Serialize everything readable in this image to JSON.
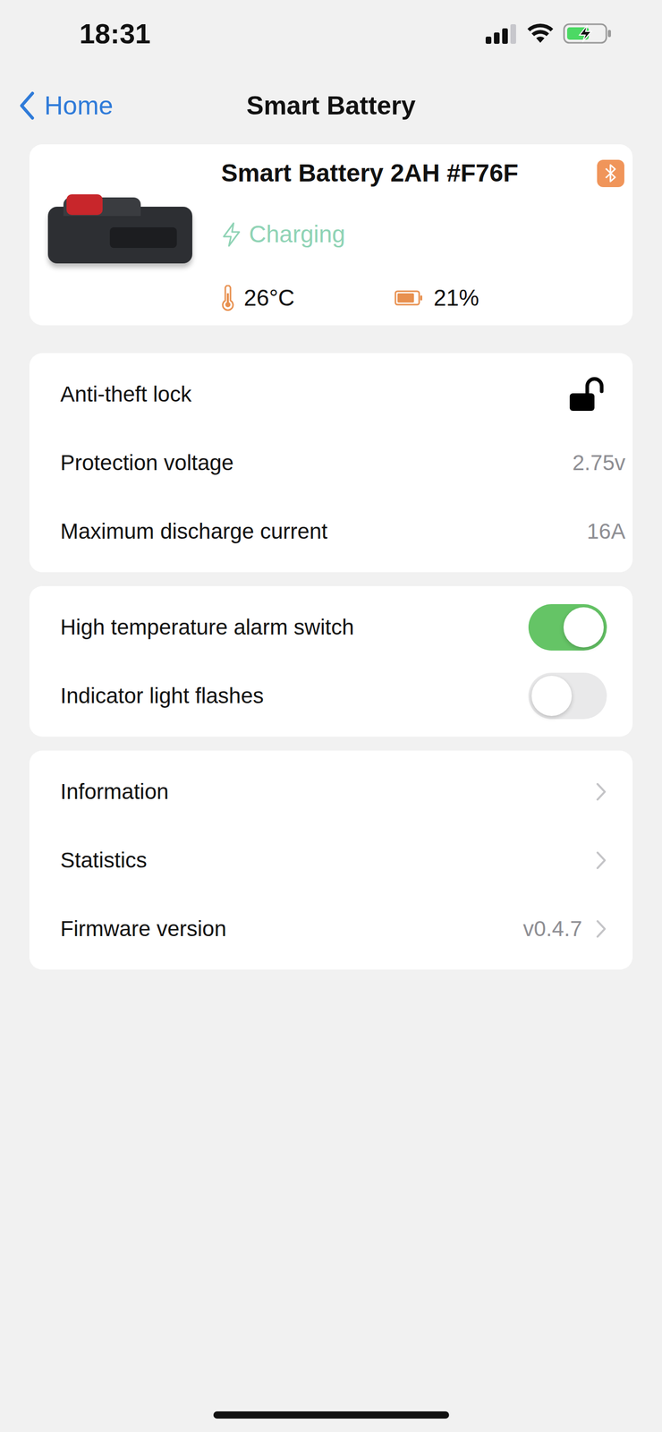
{
  "status_bar": {
    "time": "18:31",
    "signal_bars": 3,
    "battery_level": 0.7,
    "charging": true
  },
  "nav": {
    "back": "Home",
    "title": "Smart Battery"
  },
  "device": {
    "name": "Smart Battery 2AH #F76F",
    "status": "Charging",
    "temperature": "26°C",
    "battery": "21%",
    "battery_level": 0.21,
    "bluetooth_connected": true
  },
  "groups": [
    {
      "rows": [
        {
          "kind": "lock",
          "label": "Anti-theft lock",
          "locked": false
        },
        {
          "kind": "value",
          "label": "Protection voltage",
          "value": "2.75v"
        },
        {
          "kind": "value",
          "label": "Maximum discharge current",
          "value": "16A"
        }
      ]
    },
    {
      "rows": [
        {
          "kind": "toggle",
          "label": "High temperature alarm switch",
          "on": true
        },
        {
          "kind": "toggle",
          "label": "Indicator light flashes",
          "on": false
        }
      ]
    },
    {
      "rows": [
        {
          "kind": "link",
          "label": "Information"
        },
        {
          "kind": "link",
          "label": "Statistics"
        },
        {
          "kind": "link",
          "label": "Firmware version",
          "value": "v0.4.7"
        }
      ]
    }
  ]
}
